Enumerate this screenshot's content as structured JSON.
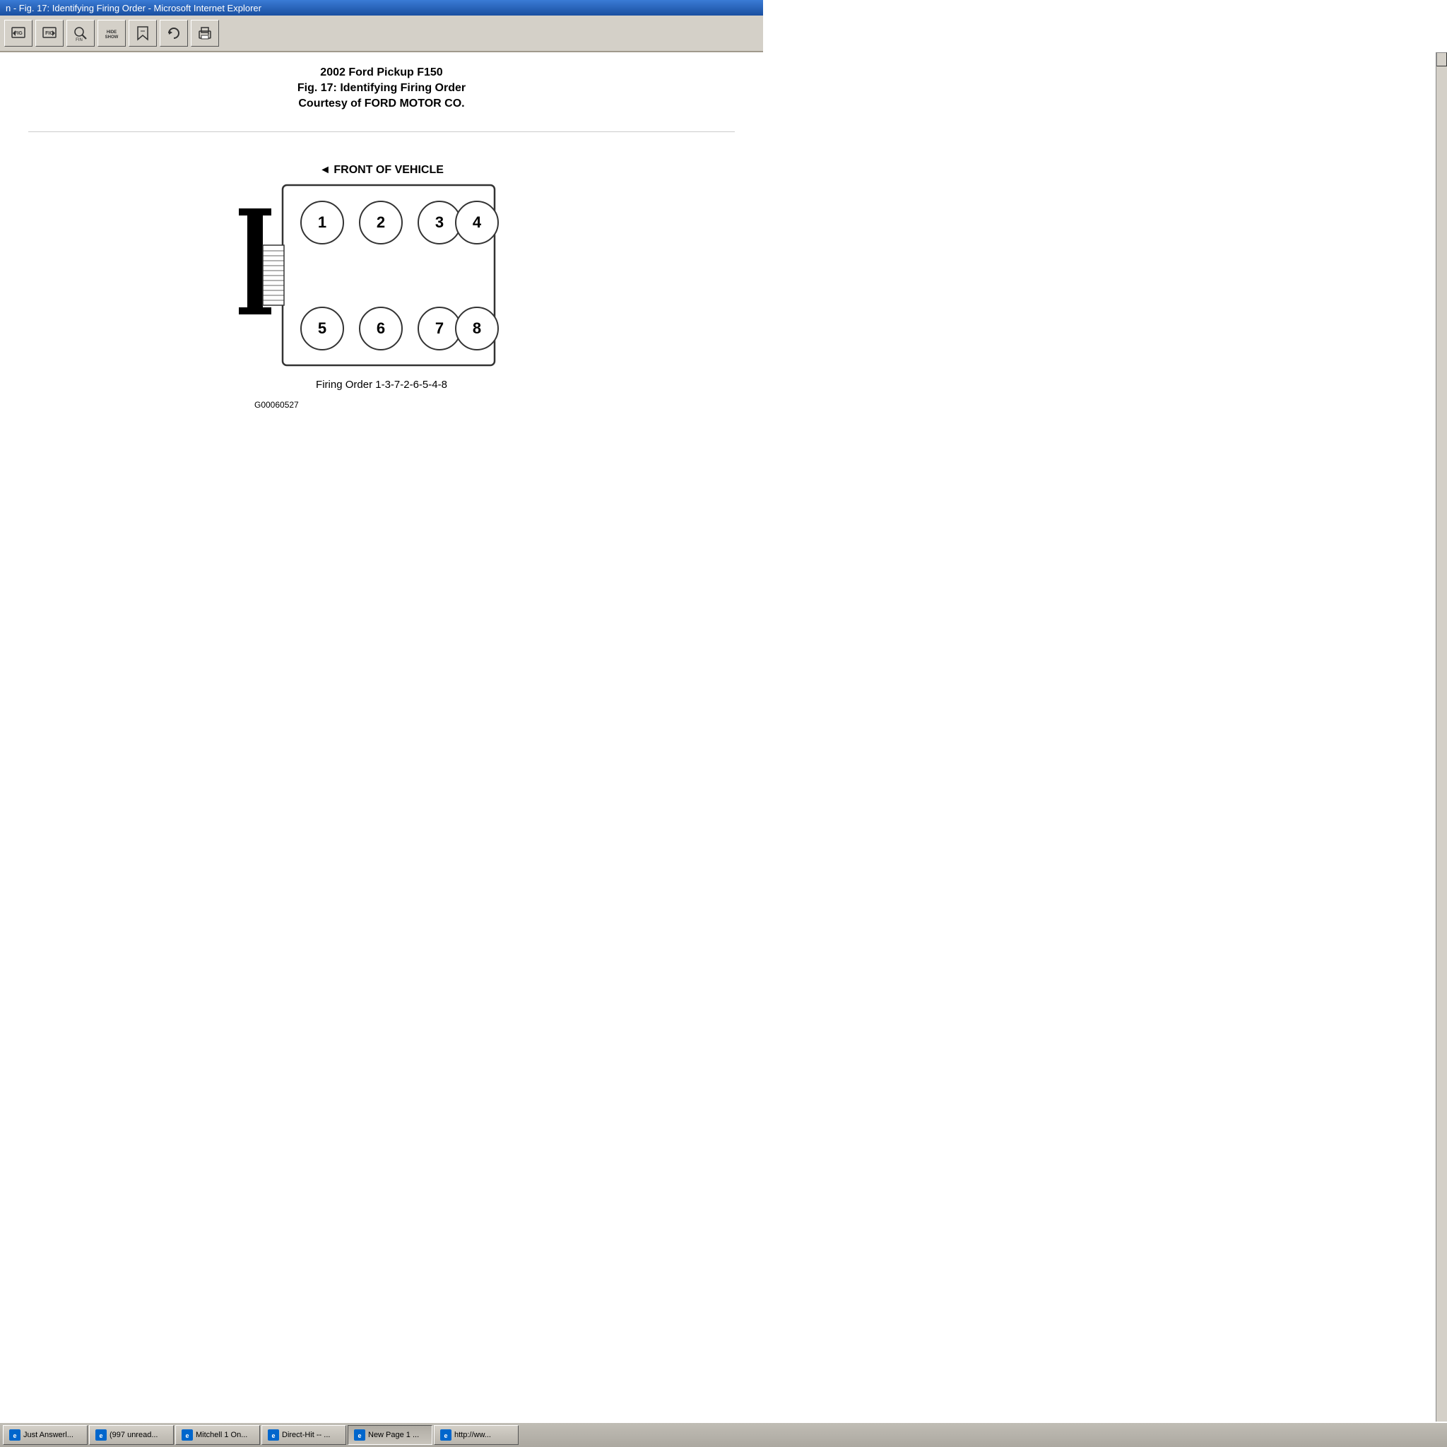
{
  "titleBar": {
    "text": "n - Fig. 17: Identifying Firing Order - Microsoft Internet Explorer"
  },
  "toolbar": {
    "buttons": [
      {
        "name": "prev-fig",
        "label": "FIG",
        "icon": "prev-fig"
      },
      {
        "name": "next-fig",
        "label": "FIG",
        "icon": "next-fig"
      },
      {
        "name": "find",
        "label": "FIND",
        "icon": "find"
      },
      {
        "name": "hide-show",
        "label": "HIDE SHOW",
        "icon": "hide-show"
      },
      {
        "name": "bookmark",
        "label": "",
        "icon": "bookmark"
      },
      {
        "name": "refresh",
        "label": "",
        "icon": "refresh"
      },
      {
        "name": "print",
        "label": "",
        "icon": "print"
      }
    ]
  },
  "content": {
    "vehicleTitle": "2002 Ford Pickup F150",
    "figTitle": "Fig. 17: Identifying Firing Order",
    "courtesy": "Courtesy of FORD MOTOR CO.",
    "diagram": {
      "frontLabel": "◄ FRONT OF VEHICLE",
      "firingOrder": "Firing Order 1-3-7-2-6-5-4-8",
      "partNumber": "G00060527",
      "cylinders": {
        "top": [
          "1",
          "2",
          "3",
          "4"
        ],
        "bottom": [
          "5",
          "6",
          "7",
          "8"
        ]
      }
    }
  },
  "taskbar": {
    "items": [
      {
        "label": "Just Answerl...",
        "active": false
      },
      {
        "label": "(997 unread...",
        "active": false
      },
      {
        "label": "Mitchell 1 On...",
        "active": false
      },
      {
        "label": "Direct-Hit -- ...",
        "active": false
      },
      {
        "label": "New Page 1 ...",
        "active": true
      },
      {
        "label": "http://ww...",
        "active": false
      }
    ]
  }
}
